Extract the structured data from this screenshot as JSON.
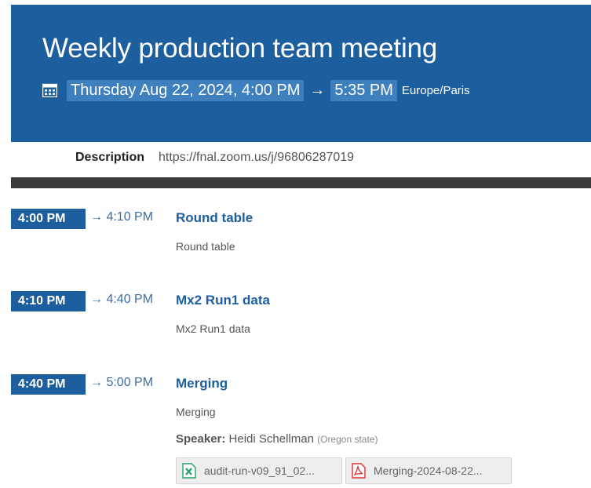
{
  "event": {
    "title": "Weekly production team meeting",
    "start": "Thursday Aug 22, 2024, 4:00 PM",
    "arrow": "→",
    "end": "5:35 PM",
    "timezone": "Europe/Paris",
    "calendar_icon": "calendar-icon"
  },
  "description": {
    "label": "Description",
    "value": "https://fnal.zoom.us/j/96806287019"
  },
  "timetable": [
    {
      "start": "4:00 PM",
      "end": "→ 4:10 PM",
      "title": "Round table",
      "description": "Round table"
    },
    {
      "start": "4:10 PM",
      "end": "→ 4:40 PM",
      "title": "Mx2 Run1 data",
      "description": "Mx2 Run1 data"
    },
    {
      "start": "4:40 PM",
      "end": "→ 5:00 PM",
      "title": "Merging",
      "description": "Merging",
      "speaker": {
        "label": "Speaker",
        "name": "Heidi Schellman",
        "affiliation": "(Oregon state)"
      },
      "attachments": [
        {
          "name": "audit-run-v09_91_02...",
          "icon": "excel-file-icon"
        },
        {
          "name": "Merging-2024-08-22...",
          "icon": "pdf-file-icon"
        }
      ]
    }
  ],
  "colors": {
    "header_bg": "#1c5e9e",
    "chip_bg": "#3e7fbd",
    "dark_bar": "#3a3a3a"
  }
}
